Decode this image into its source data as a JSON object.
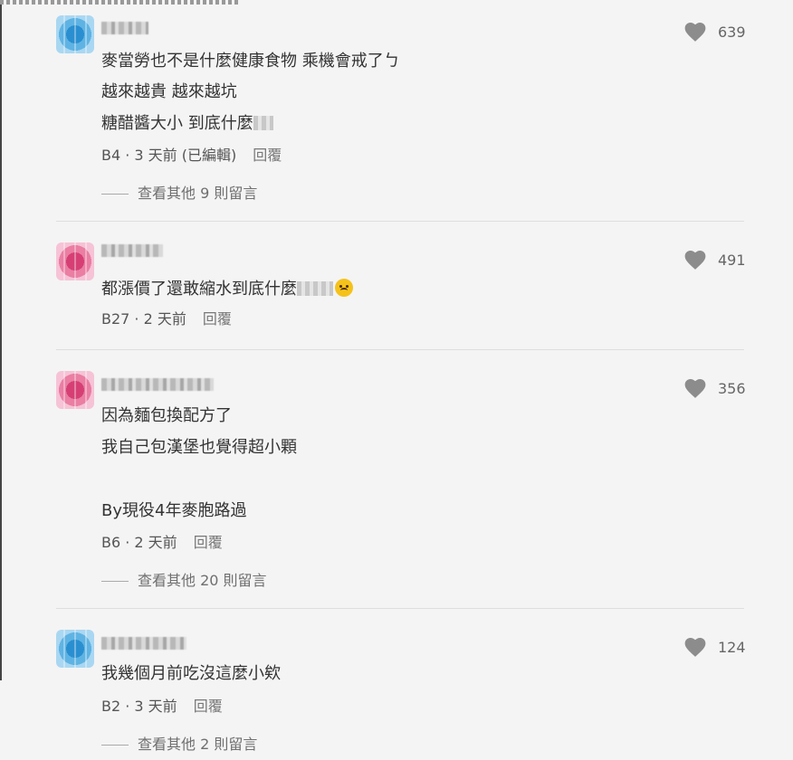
{
  "comments": [
    {
      "lines": [
        "麥當勞也不是什麼健康食物 乘機會戒了ㄅ",
        "越來越貴 越來越坑",
        "糖醋醬大小 到底什麼"
      ],
      "meta": "B4 · 3 天前 (已編輯)",
      "reply": "回覆",
      "more": "查看其他 9 則留言",
      "likes": "639"
    },
    {
      "lines": [
        "都漲價了還敢縮水到底什麼"
      ],
      "meta": "B27 · 2 天前",
      "reply": "回覆",
      "likes": "491"
    },
    {
      "lines": [
        "因為麵包換配方了",
        "我自己包漢堡也覺得超小顆",
        "By現役4年麥胞路過"
      ],
      "meta": "B6 · 2 天前",
      "reply": "回覆",
      "more": "查看其他 20 則留言",
      "likes": "356"
    },
    {
      "lines": [
        "我幾個月前吃沒這麼小欸"
      ],
      "meta": "B2 · 3 天前",
      "reply": "回覆",
      "more": "查看其他 2 則留言",
      "likes": "124"
    }
  ],
  "colors": {
    "heart": "#8c8c8c",
    "separator": "#dedede"
  }
}
